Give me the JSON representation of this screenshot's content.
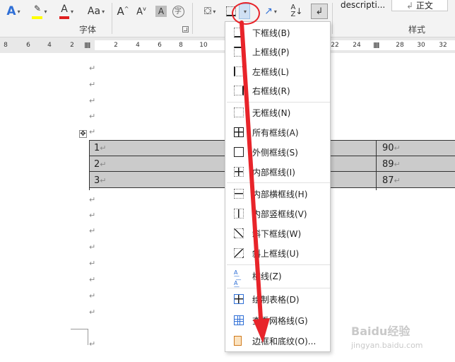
{
  "ribbon": {
    "font_group_label": "字体",
    "styles_group_label": "样式",
    "change_case_label": "Aa",
    "style_description_partial": "descripti...",
    "style_normal": "正文"
  },
  "ruler": {
    "left_ticks": [
      "8",
      "6",
      "4",
      "2"
    ],
    "right_ticks": [
      "2",
      "4",
      "6",
      "8",
      "10",
      "22",
      "24",
      "28",
      "30",
      "32"
    ]
  },
  "table": {
    "rows": [
      {
        "c1": "1",
        "c3": "90"
      },
      {
        "c1": "2",
        "c3": "89"
      },
      {
        "c1": "3",
        "c3": "87"
      }
    ],
    "paragraph_mark": "↵"
  },
  "menu": {
    "items": [
      {
        "label": "下框线(B)",
        "icon": "bottom-border-icon"
      },
      {
        "label": "上框线(P)",
        "icon": "top-border-icon"
      },
      {
        "label": "左框线(L)",
        "icon": "left-border-icon"
      },
      {
        "label": "右框线(R)",
        "icon": "right-border-icon"
      },
      {
        "label": "无框线(N)",
        "icon": "no-border-icon"
      },
      {
        "label": "所有框线(A)",
        "icon": "all-borders-icon"
      },
      {
        "label": "外侧框线(S)",
        "icon": "outside-borders-icon"
      },
      {
        "label": "内部框线(I)",
        "icon": "inside-borders-icon"
      },
      {
        "label": "内部横框线(H)",
        "icon": "inside-horizontal-border-icon"
      },
      {
        "label": "内部竖框线(V)",
        "icon": "inside-vertical-border-icon"
      },
      {
        "label": "斜下框线(W)",
        "icon": "diagonal-down-border-icon"
      },
      {
        "label": "斜上框线(U)",
        "icon": "diagonal-up-border-icon"
      },
      {
        "label": "横线(Z)",
        "icon": "horizontal-line-icon"
      },
      {
        "label": "绘制表格(D)",
        "icon": "draw-table-icon"
      },
      {
        "label": "查看网格线(G)",
        "icon": "view-gridlines-icon"
      },
      {
        "label": "边框和底纹(O)...",
        "icon": "borders-shading-icon"
      }
    ]
  },
  "watermark": {
    "text": "Baidu经验",
    "sub": "jingyan.baidu.com"
  },
  "colors": {
    "highlight": "#ffff00",
    "font_color": "#e02020",
    "annotation": "#e8242a",
    "table_shading": "#cbcbcb"
  }
}
